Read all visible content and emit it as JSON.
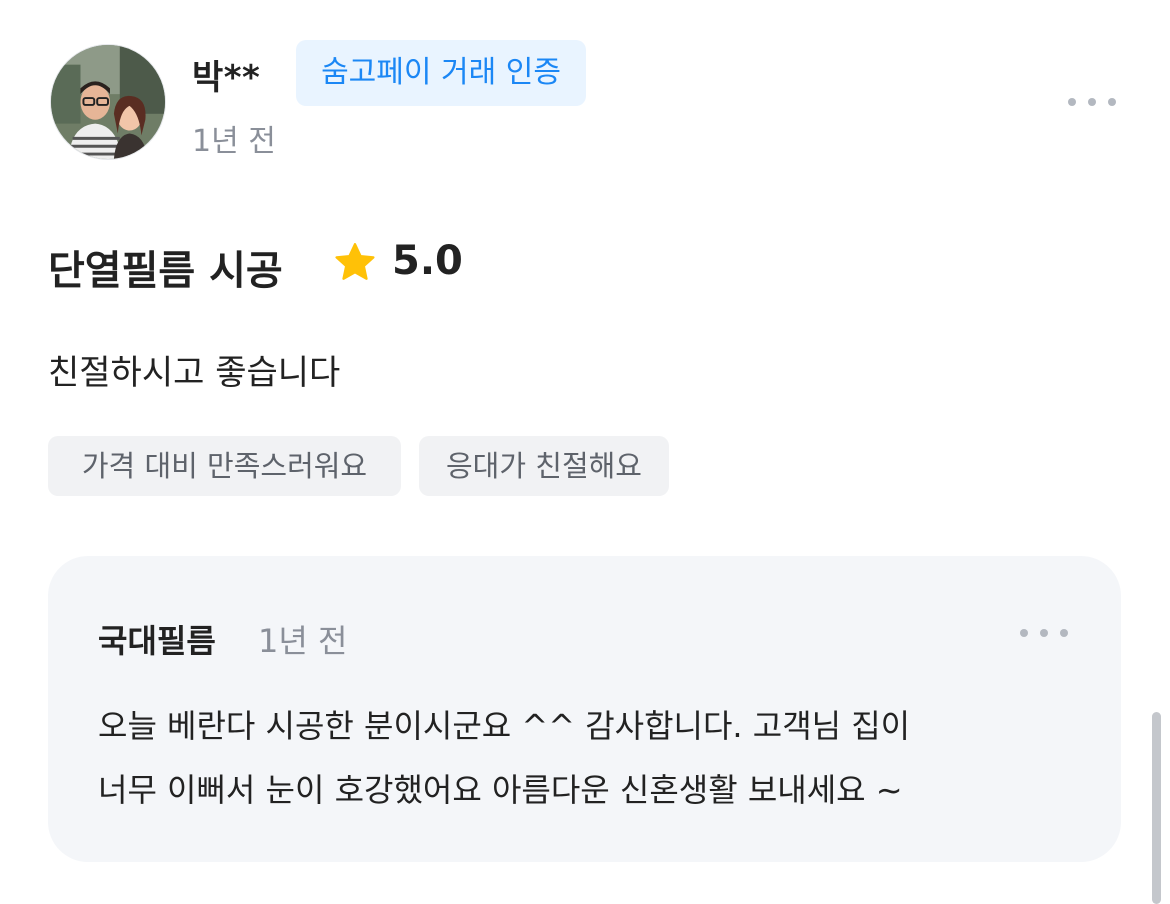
{
  "review": {
    "reviewer_name": "박**",
    "verify_badge": "숨고페이 거래 인증",
    "time": "1년 전",
    "service_title": "단열필름 시공",
    "rating": "5.0",
    "text": "친절하시고 좋습니다",
    "tags": [
      "가격 대비 만족스러워요",
      "응대가 친절해요"
    ]
  },
  "reply": {
    "author": "국대필름",
    "time": "1년 전",
    "lines": [
      "오늘 베란다 시공한 분이시군요 ^^ 감사합니다. 고객님 집이",
      "너무 이뻐서 눈이 호강했어요 아름다운 신혼생활 보내세요 ~"
    ]
  },
  "icons": {
    "more": "more-horizontal-icon",
    "star": "star-icon"
  },
  "colors": {
    "badge_bg": "#e9f4ff",
    "badge_text": "#1b87f5",
    "star": "#ffc107",
    "tag_bg": "#f1f2f4",
    "reply_bg": "#f4f6f9"
  }
}
